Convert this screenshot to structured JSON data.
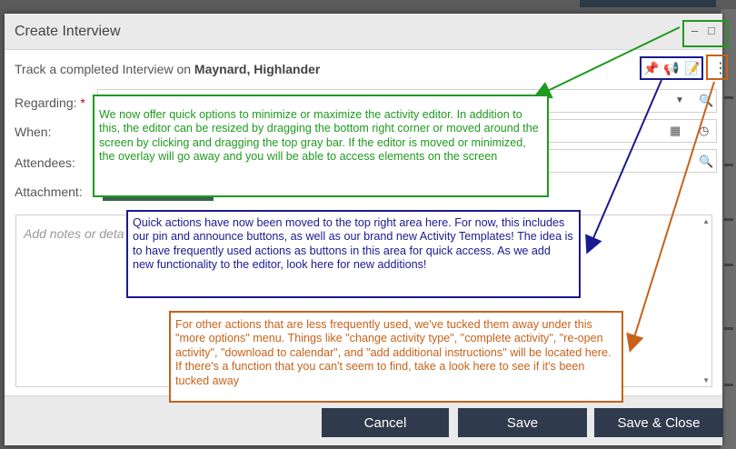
{
  "dialog": {
    "title": "Create Interview",
    "window_controls": {
      "minimize": "–",
      "maximize": "□"
    },
    "track_prefix": "Track a completed Interview on ",
    "track_name": "Maynard, Highlander",
    "quick_actions": {
      "pin": "📌",
      "announce": "📢",
      "templates": "📝",
      "more": "⋮"
    },
    "fields": {
      "regarding_label": "Regarding:",
      "required_mark": "*",
      "when_label": "When:",
      "attendees_label": "Attendees:",
      "attachment_label": "Attachment:"
    },
    "icons": {
      "dropdown": "▼",
      "search": "🔍",
      "calendar": "▦",
      "clock": "◷"
    },
    "notes_placeholder": "Add notes or deta",
    "scroll": {
      "up": "▲",
      "down": "▼"
    },
    "buttons": {
      "cancel": "Cancel",
      "save": "Save",
      "save_close": "Save & Close"
    }
  },
  "callouts": {
    "green": "We now offer quick options to minimize or maximize the activity editor.  In addition to this, the editor can be resized by dragging the bottom right corner or moved around the screen by clicking and dragging the top gray bar.  If the editor is moved or minimized, the overlay will go away and you will be able to access elements on the screen",
    "blue": "Quick actions have now been moved to the top right area here.  For now, this includes our pin and announce buttons, as well as our brand new Activity Templates!  The idea is to have frequently used actions as buttons in this area for quick access.  As we add new functionality to the editor, look here for new additions!",
    "orange": "For other actions that are less frequently used, we've tucked them away under this \"more options\" menu.  Things like \"change activity type\", \"complete activity\", \"re-open activity\", \"download to calendar\", and \"add additional instructions\" will be located here.  If there's a function that you can't seem to find, take a look here to see if it's been tucked away"
  },
  "colors": {
    "green": "#1f9a1f",
    "blue": "#1a1a8f",
    "orange": "#c8621a",
    "button": "#2f3b4d"
  }
}
